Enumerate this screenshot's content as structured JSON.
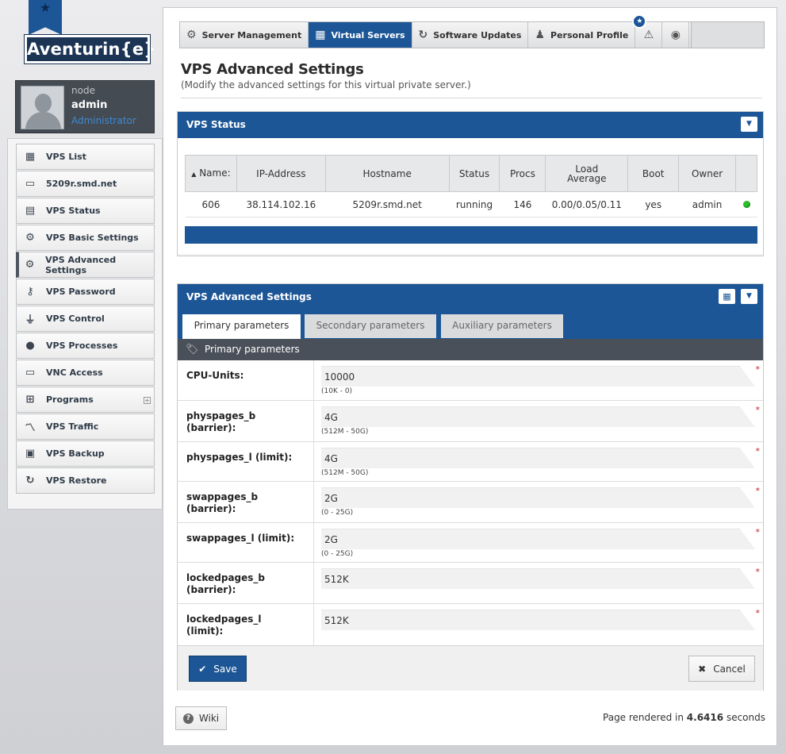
{
  "logo": {
    "text": "Aventurin{e}"
  },
  "user": {
    "node": "node",
    "name": "admin",
    "role": "Administrator"
  },
  "sidebar": {
    "items": [
      {
        "label": "VPS List",
        "icon": "grid-list-icon"
      },
      {
        "label": "5209r.smd.net",
        "icon": "laptop-icon"
      },
      {
        "label": "VPS Status",
        "icon": "status-icon"
      },
      {
        "label": "VPS Basic Settings",
        "icon": "gear-icon"
      },
      {
        "label": "VPS Advanced Settings",
        "icon": "gears-icon",
        "active": true
      },
      {
        "label": "VPS Password",
        "icon": "key-icon"
      },
      {
        "label": "VPS Control",
        "icon": "plug-icon"
      },
      {
        "label": "VPS Processes",
        "icon": "question-circle-icon"
      },
      {
        "label": "VNC Access",
        "icon": "monitor-icon"
      },
      {
        "label": "Programs",
        "icon": "sitemap-icon",
        "expandable": true
      },
      {
        "label": "VPS Traffic",
        "icon": "line-chart-icon"
      },
      {
        "label": "VPS Backup",
        "icon": "backup-icon"
      },
      {
        "label": "VPS Restore",
        "icon": "refresh-icon"
      }
    ]
  },
  "topnav": {
    "items": [
      {
        "label": "Server Management",
        "icon": "gear-icon"
      },
      {
        "label": "Virtual Servers",
        "icon": "grid-icon",
        "active": true
      },
      {
        "label": "Software Updates",
        "icon": "refresh-icon"
      },
      {
        "label": "Personal Profile",
        "icon": "user-icon"
      }
    ],
    "alert_badge": "★"
  },
  "page": {
    "title": "VPS Advanced Settings",
    "subtitle": "(Modify the advanced settings for this virtual private server.)"
  },
  "vps_status": {
    "title": "VPS Status",
    "columns": [
      "Name:",
      "IP-Address",
      "Hostname",
      "Status",
      "Procs",
      "Load Average",
      "Boot",
      "Owner"
    ],
    "row": {
      "name": "606",
      "ip": "38.114.102.16",
      "hostname": "5209r.smd.net",
      "status": "running",
      "procs": "146",
      "load": "0.00/0.05/0.11",
      "boot": "yes",
      "owner": "admin",
      "indicator_color": "#2fbf2f"
    }
  },
  "adv_settings": {
    "title": "VPS Advanced Settings",
    "tabs": [
      "Primary parameters",
      "Secondary parameters",
      "Auxiliary parameters"
    ],
    "section_title": "Primary parameters",
    "fields": [
      {
        "label": "CPU-Units:",
        "value": "10000",
        "hint": "(10K - 0)"
      },
      {
        "label": "physpages_b (barrier):",
        "value": "4G",
        "hint": "(512M - 50G)"
      },
      {
        "label": "physpages_l (limit):",
        "value": "4G",
        "hint": "(512M - 50G)"
      },
      {
        "label": "swappages_b (barrier):",
        "value": "2G",
        "hint": "(0 - 25G)"
      },
      {
        "label": "swappages_l (limit):",
        "value": "2G",
        "hint": "(0 - 25G)"
      },
      {
        "label": "lockedpages_b (barrier):",
        "value": "512K",
        "hint": ""
      },
      {
        "label": "lockedpages_l (limit):",
        "value": "512K",
        "hint": ""
      }
    ],
    "required_mark": "*",
    "save_label": "Save",
    "cancel_label": "Cancel"
  },
  "footer": {
    "wiki_label": "Wiki",
    "render_prefix": "Page rendered in",
    "render_time": "4.6416",
    "render_suffix": "seconds"
  },
  "colors": {
    "brand": "#1c5696",
    "dark": "#4a5059",
    "required": "#cc2222"
  }
}
